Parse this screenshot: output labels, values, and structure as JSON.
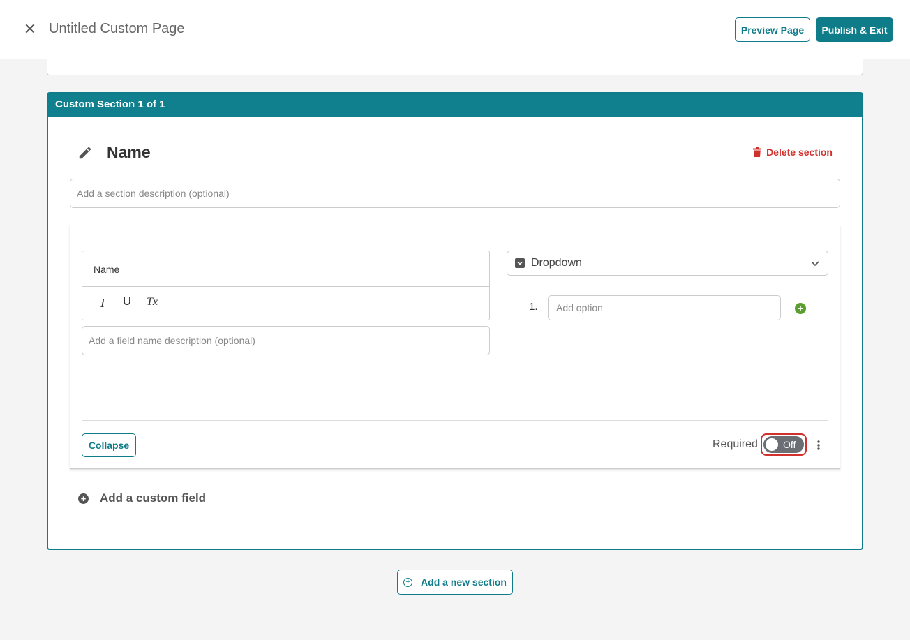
{
  "header": {
    "close_icon": "close-icon",
    "title": "Untitled Custom Page",
    "preview_label": "Preview Page",
    "publish_label": "Publish & Exit"
  },
  "section": {
    "header_label": "Custom Section 1 of 1",
    "name": "Name",
    "delete_label": "Delete section",
    "description_placeholder": "Add a section description (optional)"
  },
  "field": {
    "name_text": "Name",
    "toolbar": {
      "italic": "I",
      "underline": "U",
      "clear_format": "Tx"
    },
    "description_placeholder": "Add a field name description (optional)",
    "type_label": "Dropdown",
    "options": [
      {
        "number": "1.",
        "placeholder": "Add option"
      }
    ],
    "collapse_label": "Collapse",
    "required_label": "Required",
    "toggle_state": "Off"
  },
  "add_custom_field_label": "Add a custom field",
  "add_section_label": "Add a new section",
  "colors": {
    "accent": "#0f7c8a",
    "danger": "#d0312d",
    "add_option_green": "#5a9e2f"
  }
}
